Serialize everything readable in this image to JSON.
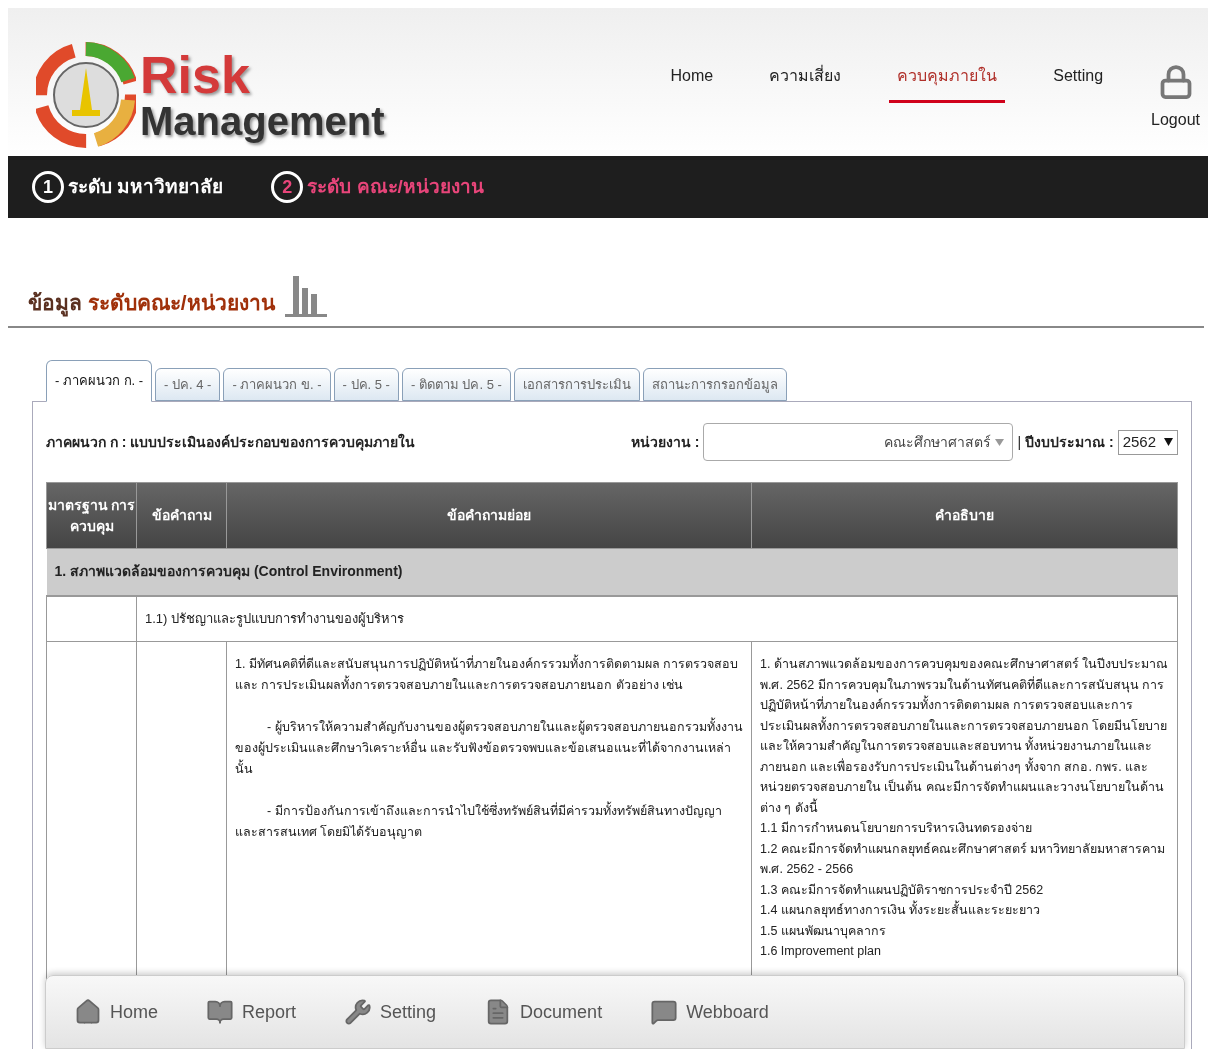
{
  "logo": {
    "word_1": "Risk",
    "word_2": "Management"
  },
  "nav": {
    "items": [
      {
        "label": "Home",
        "selected": false
      },
      {
        "label": "ความเสี่ยง",
        "selected": false
      },
      {
        "label": "ควบคุมภายใน",
        "selected": true
      },
      {
        "label": "Setting",
        "selected": false
      }
    ],
    "logout": "Logout"
  },
  "levels": [
    {
      "number": "1",
      "label": "ระดับ มหาวิทยาลัย",
      "selected": false
    },
    {
      "number": "2",
      "label": "ระดับ คณะ/หน่วยงาน",
      "selected": true
    }
  ],
  "heading": {
    "prefix": "ข้อมูล",
    "highlight": "ระดับคณะ/หน่วยงาน"
  },
  "tabs": [
    {
      "label": "- ภาคผนวก ก. -",
      "selected": true
    },
    {
      "label": "- ปค. 4 -",
      "selected": false
    },
    {
      "label": "- ภาคผนวก ข. -",
      "selected": false
    },
    {
      "label": "- ปค. 5 -",
      "selected": false
    },
    {
      "label": "- ติดตาม ปค. 5 -",
      "selected": false
    },
    {
      "label": "เอกสารการประเมิน",
      "selected": false
    },
    {
      "label": "สถานะการกรอกข้อมูล",
      "selected": false
    }
  ],
  "form": {
    "title": "ภาคผนวก ก : แบบประเมินองค์ประกอบของการควบคุมภายใน",
    "unit_label": "หน่วยงาน :",
    "unit_value": "คณะศึกษาศาสตร์",
    "separator": "|",
    "year_label": "ปีงบประมาณ :",
    "year_value": "2562"
  },
  "table": {
    "columns": [
      "มาตรฐาน การควบคุม",
      "ข้อคำถาม",
      "ข้อคำถามย่อย",
      "คำอธิบาย"
    ],
    "rows": [
      {
        "kind": "section",
        "text": "1. สภาพแวดล้อมของการควบคุม (Control Environment)"
      },
      {
        "kind": "subsection",
        "text": "1.1) ปรัชญาและรูปแบบการทำงานของผู้บริหาร"
      },
      {
        "kind": "item",
        "questions": [
          {
            "text": "1. มีทัศนคติที่ดีและสนับสนุนการปฏิบัติหน้าที่ภายในองค์กรรวมทั้งการติดตามผล การตรวจสอบ และ การประเมินผลทั้งการตรวจสอบภายในและการตรวจสอบภายนอก ตัวอย่าง เช่น",
            "indent": false
          },
          {
            "text": "- ผู้บริหารให้ความสำคัญกับงานของผู้ตรวจสอบภายในและผู้ตรวจสอบภายนอกรวมทั้งงานของผู้ประเมินและศึกษาวิเคราะห์อื่น และรับฟังข้อตรวจพบและข้อเสนอแนะที่ได้จากงานเหล่านั้น",
            "indent": true
          },
          {
            "text": "- มีการป้องกันการเข้าถึงและการนำไปใช้ซึ่งทรัพย์สินที่มีค่ารวมทั้งทรัพย์สินทางปัญญา และสารสนเทศ โดยมิได้รับอนุญาต",
            "indent": true
          }
        ],
        "description": {
          "paragraph": "1. ด้านสภาพแวดล้อมของการควบคุมของคณะศึกษาศาสตร์ ในปีงบประมาณ พ.ศ. 2562 มีการควบคุมในภาพรวมในด้านทัศนคติที่ดีและการสนับสนุน การปฏิบัติหน้าที่ภายในองค์กรรวมทั้งการติดตามผล การตรวจสอบและการประเมินผลทั้งการตรวจสอบภายในและการตรวจสอบภายนอก โดยมีนโยบายและให้ความสำคัญในการตรวจสอบและสอบทาน ทั้งหน่วยงานภายในและภายนอก และเพื่อรองรับการประเมินในด้านต่างๆ ทั้งจาก สกอ. กพร. และหน่วยตรวจสอบภายใน เป็นต้น คณะมีการจัดทำแผนและวางนโยบายในด้านต่าง ๆ ดังนี้",
          "items": [
            "1.1 มีการกำหนดนโยบายการบริหารเงินทดรองจ่าย",
            "1.2 คณะมีการจัดทำแผนกลยุทธ์คณะศึกษาศาสตร์ มหาวิทยาลัยมหาสารคาม พ.ศ. 2562 - 2566",
            "1.3 คณะมีการจัดทำแผนปฏิบัติราชการประจำปี 2562",
            "1.4 แผนกลยุทธ์ทางการเงิน ทั้งระยะสั้นและระยะยาว",
            "1.5 แผนพัฒนาบุคลากร",
            "1.6 Improvement plan"
          ]
        }
      }
    ]
  },
  "footer_nav": [
    {
      "kind": "home",
      "label": "Home"
    },
    {
      "kind": "report",
      "label": "Report"
    },
    {
      "kind": "setting",
      "label": "Setting"
    },
    {
      "kind": "document",
      "label": "Document"
    },
    {
      "kind": "webboard",
      "label": "Webboard"
    }
  ]
}
